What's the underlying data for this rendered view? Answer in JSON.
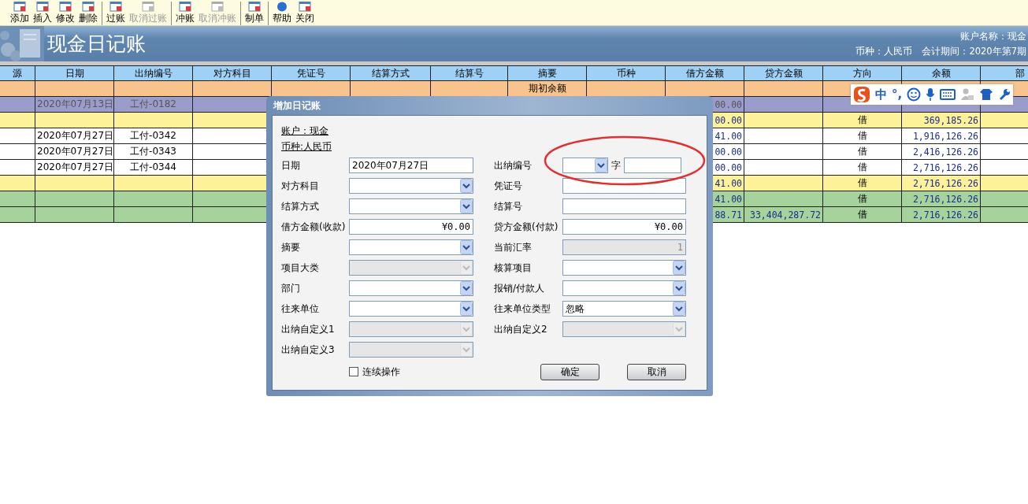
{
  "toolbar": {
    "groups": [
      [
        {
          "label": "添加",
          "disabled": false
        },
        {
          "label": "插入",
          "disabled": false
        },
        {
          "label": "修改",
          "disabled": false
        },
        {
          "label": "删除",
          "disabled": false
        }
      ],
      [
        {
          "label": "过账",
          "disabled": false
        },
        {
          "label": "取消过账",
          "disabled": true
        }
      ],
      [
        {
          "label": "冲账",
          "disabled": false
        },
        {
          "label": "取消冲账",
          "disabled": true
        }
      ],
      [
        {
          "label": "制单",
          "disabled": false
        }
      ],
      [
        {
          "label": "帮助",
          "disabled": false
        },
        {
          "label": "关闭",
          "disabled": false
        }
      ]
    ]
  },
  "banner": {
    "title": "现金日记账",
    "account": "账户名称：现金",
    "currency": "币种：人民币",
    "period": "会计期间：2020年第7期"
  },
  "table": {
    "columns": [
      "源",
      "日期",
      "出纳编号",
      "对方科目",
      "凭证号",
      "结算方式",
      "结算号",
      "摘要",
      "币种",
      "借方金额",
      "贷方金额",
      "方向",
      "余额",
      "部"
    ],
    "rows": [
      {
        "color": "#f8c38c",
        "cells": [
          null,
          null,
          null,
          null,
          null,
          null,
          null,
          "期初余额",
          null,
          null,
          null,
          null,
          null,
          null
        ]
      },
      {
        "color": "#9c9ccc",
        "cells": [
          null,
          "2020年07月13日",
          "工付-0182",
          null,
          null,
          null,
          null,
          null,
          null,
          "00.00",
          null,
          null,
          null,
          null
        ]
      },
      {
        "color": "#fdf19a",
        "cells": [
          null,
          null,
          null,
          null,
          null,
          null,
          null,
          null,
          null,
          "00.00",
          null,
          "借",
          "369,185.26",
          null
        ]
      },
      {
        "color": "#ffffff",
        "cells": [
          null,
          "2020年07月27日",
          "工付-0342",
          null,
          null,
          null,
          null,
          null,
          null,
          "41.00",
          null,
          "借",
          "1,916,126.26",
          null
        ]
      },
      {
        "color": "#ffffff",
        "cells": [
          null,
          "2020年07月27日",
          "工付-0343",
          null,
          null,
          null,
          null,
          null,
          null,
          "00.00",
          null,
          "借",
          "2,416,126.26",
          null
        ]
      },
      {
        "color": "#ffffff",
        "cells": [
          null,
          "2020年07月27日",
          "工付-0344",
          null,
          null,
          null,
          null,
          null,
          null,
          "00.00",
          null,
          "借",
          "2,716,126.26",
          null
        ]
      },
      {
        "color": "#fdf19a",
        "cells": [
          null,
          null,
          null,
          null,
          null,
          null,
          null,
          null,
          null,
          "41.00",
          null,
          "借",
          "2,716,126.26",
          null
        ]
      },
      {
        "color": "#a6d39c",
        "cells": [
          null,
          null,
          null,
          null,
          null,
          null,
          null,
          null,
          null,
          "41.00",
          null,
          "借",
          "2,716,126.26",
          null
        ]
      },
      {
        "color": "#a6d39c",
        "cells": [
          null,
          null,
          null,
          null,
          null,
          null,
          null,
          null,
          null,
          "88.71",
          "33,404,287.72",
          "借",
          "2,716,126.26",
          null
        ]
      }
    ]
  },
  "dialog": {
    "title": "增加日记账",
    "account": "账户：现金",
    "currency": "币种:人民币",
    "rows": [
      {
        "left": {
          "label": "日期",
          "kind": "text",
          "value": "2020年07月27日",
          "disabled": false
        },
        "right": {
          "label": "出纳编号",
          "kind": "numbered",
          "suffix": "字",
          "disabled": false
        }
      },
      {
        "left": {
          "label": "对方科目",
          "kind": "combo",
          "disabled": false
        },
        "right": {
          "label": "凭证号",
          "kind": "text",
          "disabled": false
        }
      },
      {
        "left": {
          "label": "结算方式",
          "kind": "combo",
          "disabled": false
        },
        "right": {
          "label": "结算号",
          "kind": "text",
          "disabled": false
        }
      },
      {
        "left": {
          "label": "借方金额(收款)",
          "kind": "amount",
          "value": "¥0.00",
          "disabled": false
        },
        "right": {
          "label": "贷方金额(付款)",
          "kind": "amount",
          "value": "¥0.00",
          "disabled": false
        }
      },
      {
        "left": {
          "label": "摘要",
          "kind": "combo",
          "disabled": false
        },
        "right": {
          "label": "当前汇率",
          "kind": "amount",
          "value": "1",
          "disabled": true
        }
      },
      {
        "left": {
          "label": "项目大类",
          "kind": "combo",
          "disabled": true
        },
        "right": {
          "label": "核算项目",
          "kind": "combo",
          "disabled": false
        }
      },
      {
        "left": {
          "label": "部门",
          "kind": "combo",
          "disabled": false
        },
        "right": {
          "label": "报销/付款人",
          "kind": "combo",
          "disabled": false
        }
      },
      {
        "left": {
          "label": "往来单位",
          "kind": "combo",
          "disabled": false
        },
        "right": {
          "label": "往来单位类型",
          "kind": "combo",
          "value": "忽略",
          "disabled": false
        }
      },
      {
        "left": {
          "label": "出纳自定义1",
          "kind": "combo",
          "disabled": true
        },
        "right": {
          "label": "出纳自定义2",
          "kind": "combo",
          "disabled": true
        }
      },
      {
        "left": {
          "label": "出纳自定义3",
          "kind": "combo",
          "disabled": true
        }
      }
    ],
    "checkbox": {
      "label": "连续操作",
      "checked": false
    },
    "buttons": [
      "确定",
      "取消"
    ]
  },
  "annotation": {
    "kind": "ellipse"
  },
  "ime_bar": {
    "mode": "中",
    "punctuation": "°,"
  }
}
